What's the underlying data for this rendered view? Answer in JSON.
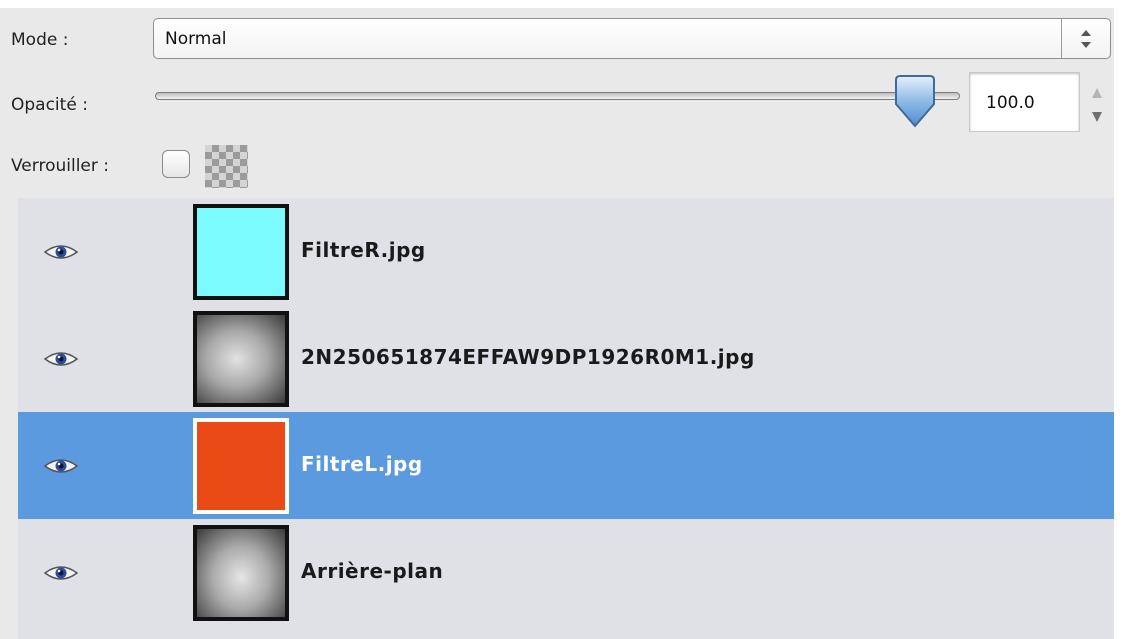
{
  "mode": {
    "label": "Mode :",
    "value": "Normal"
  },
  "opacity": {
    "label": "Opacité :",
    "value": "100.0",
    "level_percent": 100
  },
  "lock": {
    "label": "Verrouiller :",
    "pixels_locked": false
  },
  "layers": [
    {
      "name": "FiltreR.jpg",
      "visible": true,
      "selected": false,
      "thumbnail": "cyan-fill",
      "color": "#7cfbff"
    },
    {
      "name": "2N250651874EFFAW9DP1926R0M1.jpg",
      "visible": true,
      "selected": false,
      "thumbnail": "grayscale-photo",
      "color": "#8a8a8a"
    },
    {
      "name": "FiltreL.jpg",
      "visible": true,
      "selected": true,
      "thumbnail": "orange-fill",
      "color": "#ea4a16"
    },
    {
      "name": "Arrière-plan",
      "visible": true,
      "selected": false,
      "thumbnail": "grayscale-photo",
      "color": "#8a8a8a"
    }
  ],
  "colors": {
    "selection": "#5c9ae0",
    "list_background": "#dfe1e7",
    "panel_background": "#e9e9e9"
  }
}
